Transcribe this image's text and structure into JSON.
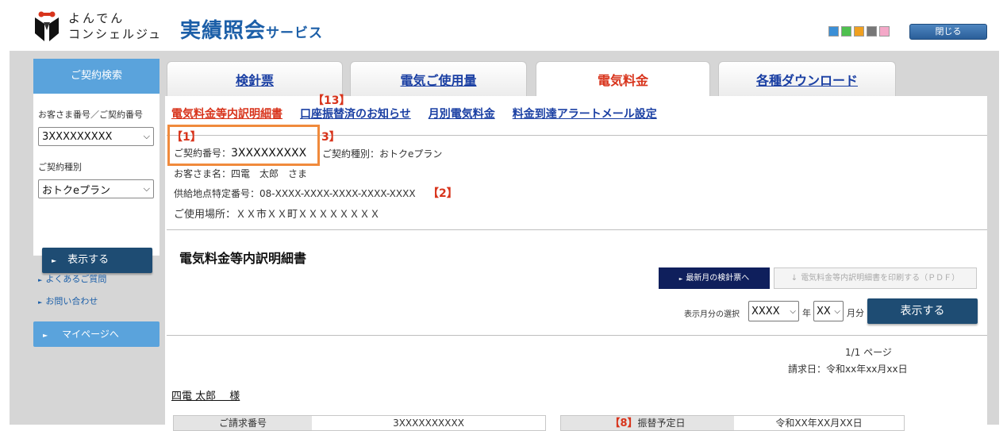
{
  "header": {
    "logo_line1": "よんでん",
    "logo_line2": "コンシェルジュ",
    "service_title": "実績照会",
    "service_title_suffix": "サービス",
    "close_label": "閉じる",
    "swatch_colors": [
      "#3b8fd6",
      "#4fc04f",
      "#f0a020",
      "#777777",
      "#f4a8c8"
    ]
  },
  "sidebar": {
    "heading": "ご契約検索",
    "customer_number_label": "お客さま番号／ご契約番号",
    "customer_number_value": "3XXXXXXXXX",
    "contract_type_label": "ご契約種別",
    "contract_type_value": "おトクeプラン",
    "show_button": "表示する",
    "faq_link": "よくあるご質問",
    "contact_link": "お問い合わせ",
    "mypage_button": "マイページへ"
  },
  "tabs": [
    {
      "label": "検針票",
      "active": false
    },
    {
      "label": "電気ご使用量",
      "active": false
    },
    {
      "label": "電気料金",
      "active": true
    },
    {
      "label": "各種ダウンロード",
      "active": false
    }
  ],
  "subnav": [
    {
      "label": "電気料金等内訳明細書",
      "current": true
    },
    {
      "label": "口座振替済のお知らせ",
      "current": false
    },
    {
      "label": "月別電気料金",
      "current": false
    },
    {
      "label": "料金到達アラートメール設定",
      "current": false
    }
  ],
  "annotations": {
    "a13": "【13】",
    "a1": "【1】",
    "a3": "3】",
    "a2": "【2】",
    "a8": "【8】"
  },
  "contract_info": {
    "contract_number_label": "ご契約番号：",
    "contract_number": "3XXXXXXXXX",
    "contract_type": "ご契約種別：おトクeプラン",
    "customer_name": "お客さま名：四電　太郎　さま",
    "supply_point": "供給地点特定番号：08-XXXX-XXXX-XXXX-XXXX-XXXX",
    "usage_location": "ご使用場所：ＸＸ市ＸＸ町ＸＸＸＸＸＸＸＸ"
  },
  "statement": {
    "title": "電気料金等内訳明細書",
    "latest_button": "最新月の検針票へ",
    "print_button": "電気料金等内訳明細書を印刷する（ＰＤＦ）",
    "month_select_label": "表示月分の選択",
    "year_value": "XXXX",
    "year_unit": "年",
    "month_value": "XX",
    "month_unit": "月分",
    "show_button": "表示する",
    "page_count": "1/1 ページ",
    "billing_date": "請求日：令和xx年xx月xx日",
    "customer_name": "四電 太郎　 様",
    "table_left_label": "ご請求番号",
    "table_left_value": "3XXXXXXXXXX",
    "table_right_label": "振替予定日",
    "table_right_value": "令和XX年XX月XX日"
  }
}
